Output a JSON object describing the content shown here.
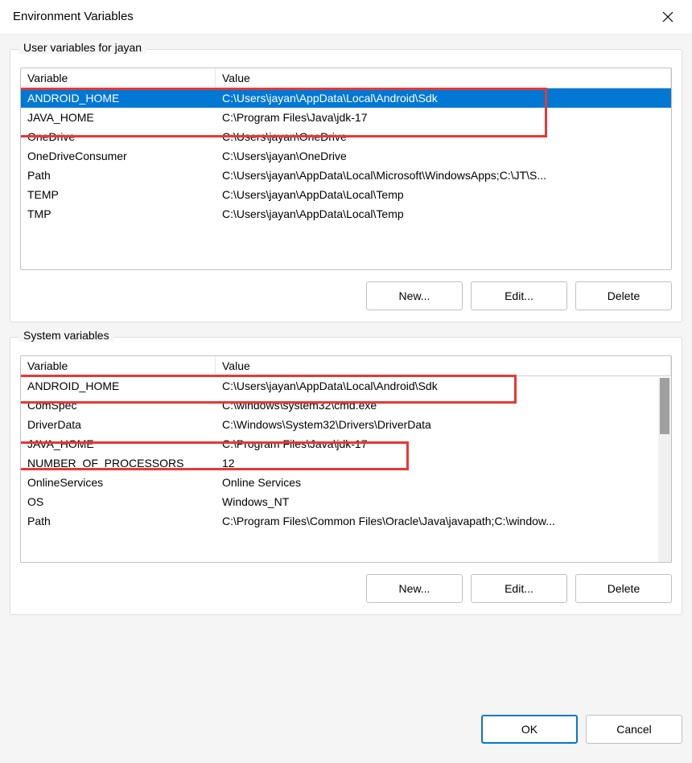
{
  "window": {
    "title": "Environment Variables"
  },
  "userGroup": {
    "label": "User variables for jayan",
    "columns": {
      "variable": "Variable",
      "value": "Value"
    },
    "rows": [
      {
        "variable": "ANDROID_HOME",
        "value": "C:\\Users\\jayan\\AppData\\Local\\Android\\Sdk",
        "selected": true
      },
      {
        "variable": "JAVA_HOME",
        "value": "C:\\Program Files\\Java\\jdk-17"
      },
      {
        "variable": "OneDrive",
        "value": "C:\\Users\\jayan\\OneDrive"
      },
      {
        "variable": "OneDriveConsumer",
        "value": "C:\\Users\\jayan\\OneDrive"
      },
      {
        "variable": "Path",
        "value": "C:\\Users\\jayan\\AppData\\Local\\Microsoft\\WindowsApps;C:\\JT\\S..."
      },
      {
        "variable": "TEMP",
        "value": "C:\\Users\\jayan\\AppData\\Local\\Temp"
      },
      {
        "variable": "TMP",
        "value": "C:\\Users\\jayan\\AppData\\Local\\Temp"
      }
    ],
    "buttons": {
      "new": "New...",
      "edit": "Edit...",
      "delete": "Delete"
    }
  },
  "systemGroup": {
    "label": "System variables",
    "columns": {
      "variable": "Variable",
      "value": "Value"
    },
    "rows": [
      {
        "variable": "ANDROID_HOME",
        "value": "C:\\Users\\jayan\\AppData\\Local\\Android\\Sdk"
      },
      {
        "variable": "ComSpec",
        "value": "C:\\windows\\system32\\cmd.exe"
      },
      {
        "variable": "DriverData",
        "value": "C:\\Windows\\System32\\Drivers\\DriverData"
      },
      {
        "variable": "JAVA_HOME",
        "value": "C:\\Program Files\\Java\\jdk-17"
      },
      {
        "variable": "NUMBER_OF_PROCESSORS",
        "value": "12"
      },
      {
        "variable": "OnlineServices",
        "value": "Online Services"
      },
      {
        "variable": "OS",
        "value": "Windows_NT"
      },
      {
        "variable": "Path",
        "value": "C:\\Program Files\\Common Files\\Oracle\\Java\\javapath;C:\\window..."
      }
    ],
    "buttons": {
      "new": "New...",
      "edit": "Edit...",
      "delete": "Delete"
    }
  },
  "footer": {
    "ok": "OK",
    "cancel": "Cancel"
  }
}
